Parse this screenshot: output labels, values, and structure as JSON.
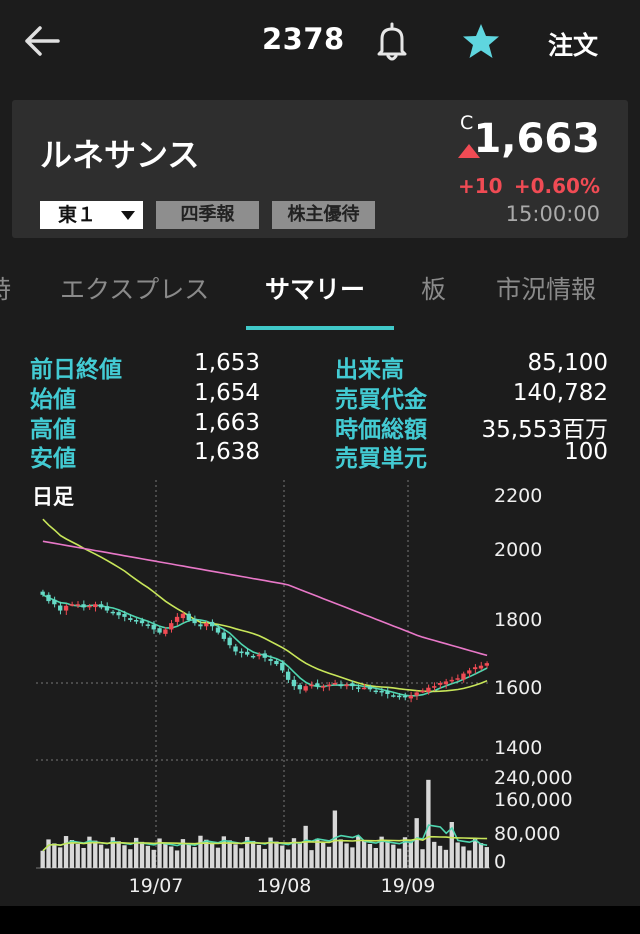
{
  "header": {
    "back_icon": "arrow-left-icon",
    "code": "2378",
    "bell_icon": "bell-icon",
    "star_icon": "star-icon",
    "order_label": "注文",
    "accent": "#40c8c8"
  },
  "quote": {
    "name": "ルネサンス",
    "c_mark": "C",
    "price": "1,663",
    "change": "+10",
    "change_pct": "+0.60%",
    "time": "15:00:00",
    "market": "東１",
    "tag_quarterly": "四季報",
    "tag_benefit": "株主優待",
    "up_color": "#f04b54"
  },
  "tabs": [
    {
      "label": "時"
    },
    {
      "label": "エクスプレス"
    },
    {
      "label": "サマリー",
      "active": true
    },
    {
      "label": "板"
    },
    {
      "label": "市況情報"
    }
  ],
  "stats": [
    {
      "label": "前日終値",
      "value": "1,653"
    },
    {
      "label": "始値",
      "value": "1,654"
    },
    {
      "label": "高値",
      "value": "1,663"
    },
    {
      "label": "安値",
      "value": "1,638"
    },
    {
      "label": "出来高",
      "value": "85,100"
    },
    {
      "label": "売買代金",
      "value": "140,782"
    },
    {
      "label": "時価総額",
      "value": "35,553百万"
    },
    {
      "label": "売買単元",
      "value": "100"
    }
  ],
  "chart_data": {
    "type": "candlestick",
    "title": "日足",
    "price_ticks": [
      "2200",
      "2000",
      "1800",
      "1600",
      "1400"
    ],
    "volume_ticks": [
      "240,000",
      "160,000",
      "80,000",
      "0"
    ],
    "x_ticks": [
      "19/07",
      "19/08",
      "19/09"
    ],
    "price_close": [
      1880,
      1860,
      1850,
      1830,
      1845,
      1850,
      1850,
      1840,
      1845,
      1850,
      1840,
      1830,
      1825,
      1815,
      1810,
      1800,
      1795,
      1790,
      1785,
      1770,
      1760,
      1770,
      1790,
      1810,
      1820,
      1800,
      1790,
      1780,
      1790,
      1780,
      1760,
      1740,
      1720,
      1700,
      1695,
      1690,
      1685,
      1690,
      1680,
      1670,
      1660,
      1640,
      1610,
      1590,
      1580,
      1590,
      1595,
      1590,
      1590,
      1595,
      1600,
      1590,
      1595,
      1590,
      1585,
      1585,
      1580,
      1575,
      1570,
      1565,
      1560,
      1555,
      1555,
      1560,
      1570,
      1575,
      1585,
      1590,
      1600,
      1605,
      1610,
      1615,
      1630,
      1640,
      1650,
      1655,
      1663
    ],
    "ma_pink": [
      2050,
      1960
    ],
    "volume_note": "daily volume bars with 2 moving averages",
    "candle_up_color": "#f04b54",
    "candle_down_color": "#66d9c6",
    "ma_short_color": "#4fd7b0",
    "ma_mid_color": "#c8e65a",
    "ma_long_color": "#e878c8"
  }
}
